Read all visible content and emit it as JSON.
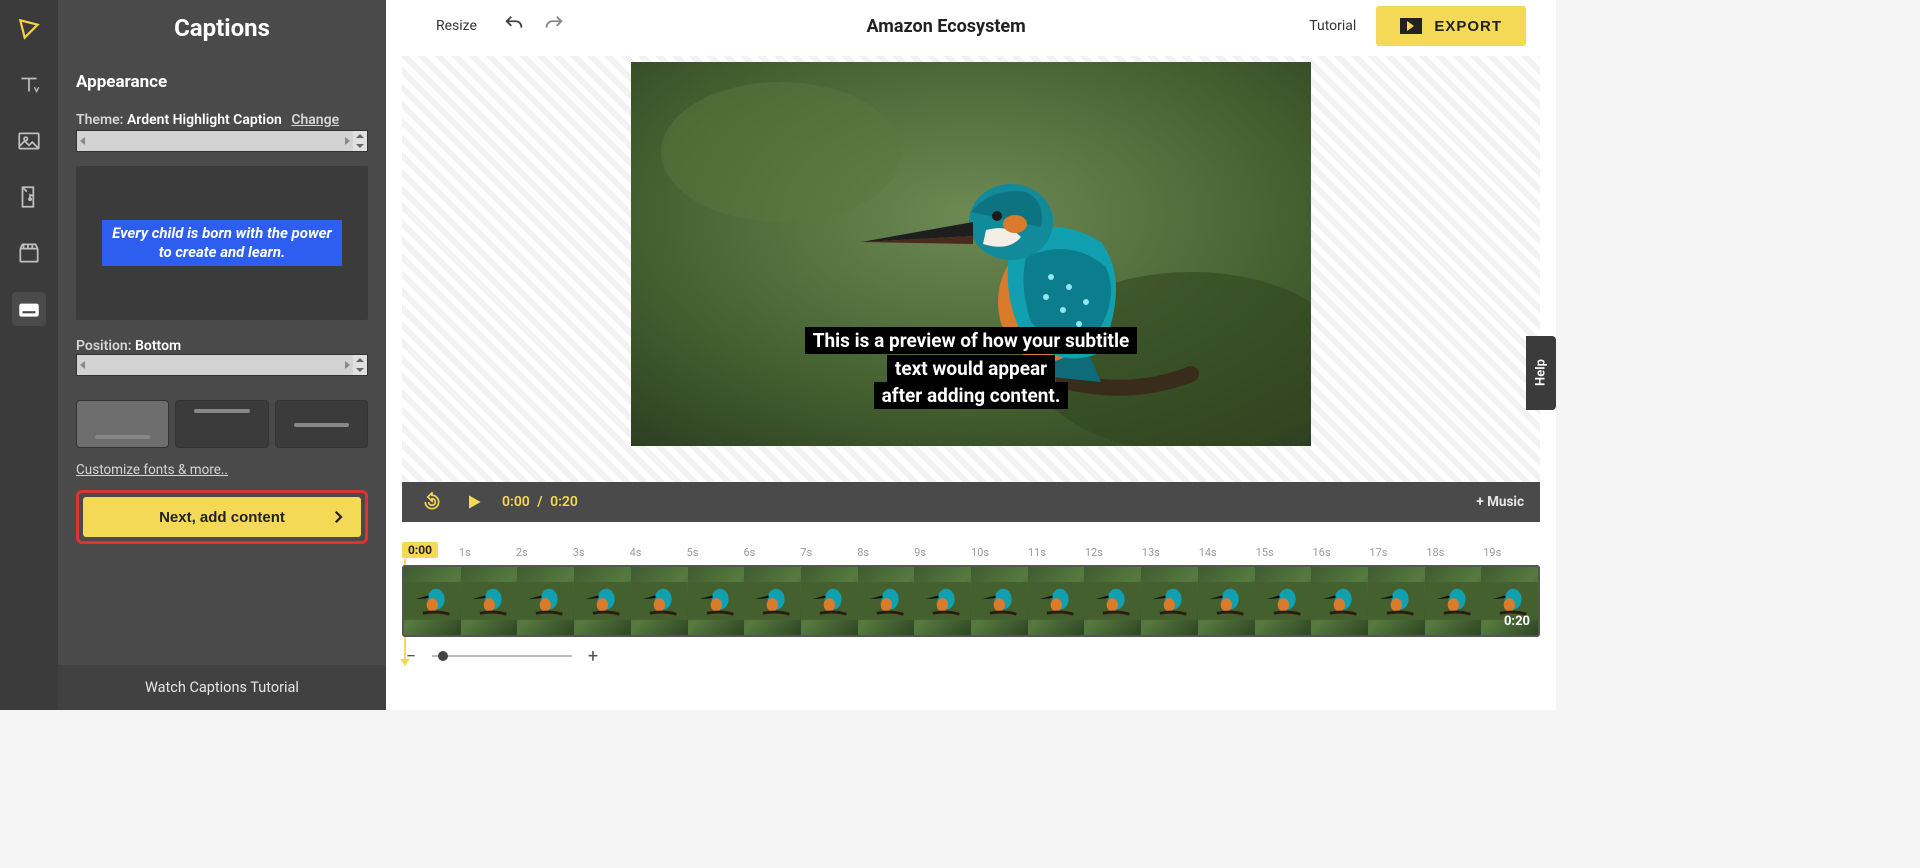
{
  "rail": {
    "items": [
      "logo",
      "text",
      "image",
      "audio",
      "script",
      "captions"
    ]
  },
  "panel": {
    "title": "Captions",
    "section": "Appearance",
    "theme_label": "Theme:",
    "theme_name": "Ardent Highlight Caption",
    "theme_change": "Change",
    "sample_line1": "Every child is born with the power",
    "sample_line2": "to create and learn.",
    "position_label": "Position:",
    "position_value": "Bottom",
    "customize_link": "Customize fonts & more..",
    "next_label": "Next, add content",
    "watch_tutorial": "Watch Captions Tutorial"
  },
  "topbar": {
    "resize": "Resize",
    "title": "Amazon Ecosystem",
    "tutorial": "Tutorial",
    "export": "EXPORT"
  },
  "subtitle": {
    "line1": "This is a preview of how your subtitle text would appear",
    "line2": "after adding content."
  },
  "player": {
    "current": "0:00",
    "sep": "/",
    "total": "0:20",
    "music": "+ Music"
  },
  "timeline": {
    "playhead": "0:00",
    "clip_duration": "0:20",
    "ticks": [
      "",
      "1s",
      "2s",
      "3s",
      "4s",
      "5s",
      "6s",
      "7s",
      "8s",
      "9s",
      "10s",
      "11s",
      "12s",
      "13s",
      "14s",
      "15s",
      "16s",
      "17s",
      "18s",
      "19s"
    ]
  },
  "help_tab": "Help"
}
